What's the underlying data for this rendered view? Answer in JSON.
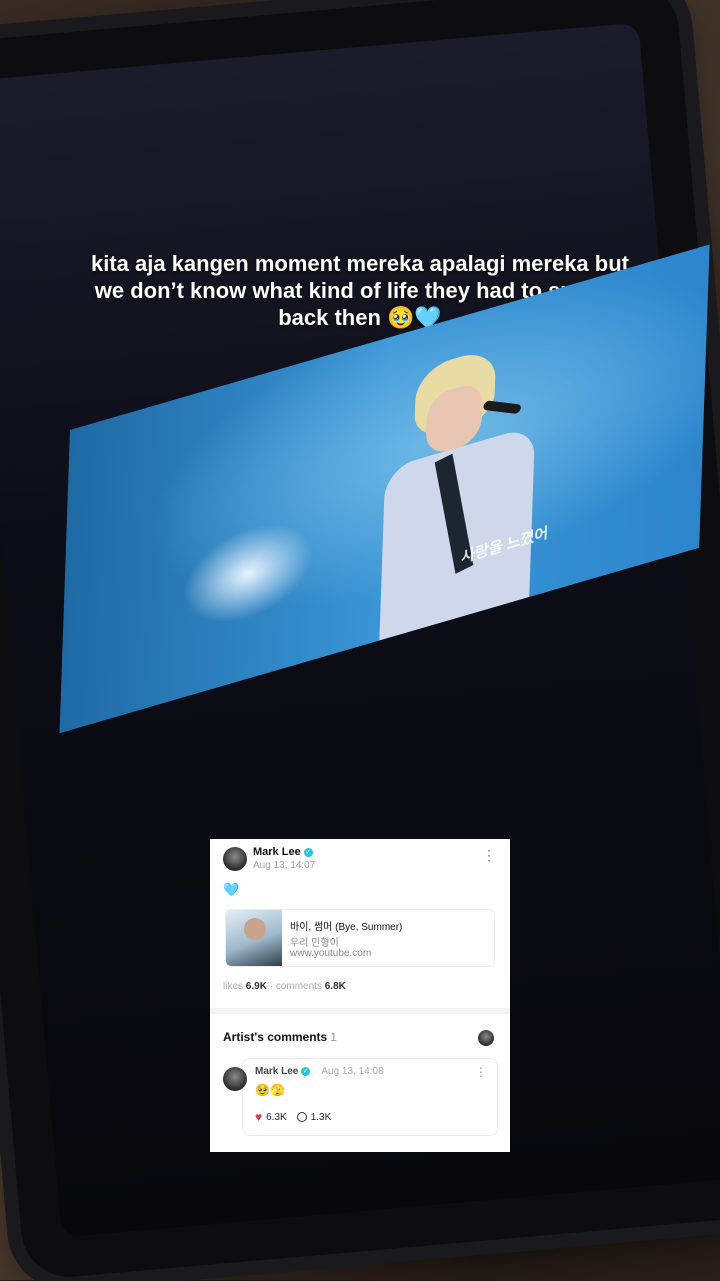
{
  "caption": "kita aja kangen moment mereka apalagi mereka but we don’t know what kind of life they had to survive back then 🥹🩵",
  "video": {
    "subtitle": "사랑을 느꼈어"
  },
  "post": {
    "author": "Mark Lee",
    "date": "Aug 13, 14:07",
    "more_icon": "⋮",
    "body_emoji": "🩵",
    "link": {
      "title": "바이, 썸머 (Bye, Summer)",
      "subtitle": "우리 민형이",
      "url": "www.youtube.com"
    },
    "likes_label": "likes",
    "likes": "6.9K",
    "comments_label": "comments",
    "comments": "6.8K",
    "separator": "·"
  },
  "artist_comments": {
    "title": "Artist's comments",
    "count": "1",
    "comment": {
      "author": "Mark Lee",
      "date": "Aug 13, 14:08",
      "more_icon": "⋮",
      "text": "🥹🫣",
      "likes": "6.3K",
      "replies": "1.3K"
    }
  },
  "colors": {
    "accent": "#23c6d6",
    "heart": "#e5343f"
  }
}
